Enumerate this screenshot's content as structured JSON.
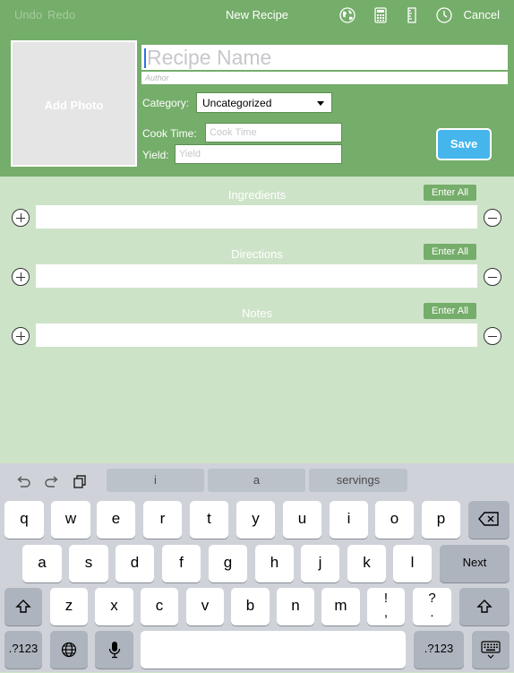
{
  "nav": {
    "undo": "Undo",
    "redo": "Redo",
    "title": "New Recipe",
    "cancel": "Cancel",
    "icons": [
      "globe-icon",
      "calculator-icon",
      "ruler-icon",
      "timer-icon"
    ]
  },
  "header": {
    "add_photo": "Add Photo",
    "recipe_name_placeholder": "Recipe Name",
    "author_placeholder": "Author",
    "category_label": "Category:",
    "category_value": "Uncategorized",
    "cook_time_label": "Cook Time:",
    "cook_time_placeholder": "Cook Time",
    "yield_label": "Yield:",
    "yield_placeholder": "Yield",
    "save": "Save"
  },
  "sections": [
    {
      "title": "Ingredients",
      "enter_all": "Enter All"
    },
    {
      "title": "Directions",
      "enter_all": "Enter All"
    },
    {
      "title": "Notes",
      "enter_all": "Enter All"
    }
  ],
  "keyboard": {
    "suggestions": [
      "i",
      "a",
      "servings"
    ],
    "row1": [
      "q",
      "w",
      "e",
      "r",
      "t",
      "y",
      "u",
      "i",
      "o",
      "p"
    ],
    "row2": [
      "a",
      "s",
      "d",
      "f",
      "g",
      "h",
      "j",
      "k",
      "l"
    ],
    "next": "Next",
    "row3": [
      "z",
      "x",
      "c",
      "v",
      "b",
      "n",
      "m"
    ],
    "punct1": "!",
    "punct1_alt": ",",
    "punct2": "?",
    "punct2_alt": ".",
    "numbers": ".?123"
  },
  "colors": {
    "header_green": "#75ad6a",
    "background_green": "#cde3c8",
    "save_blue": "#45b5ec",
    "caret_blue": "#2f6fe3"
  }
}
